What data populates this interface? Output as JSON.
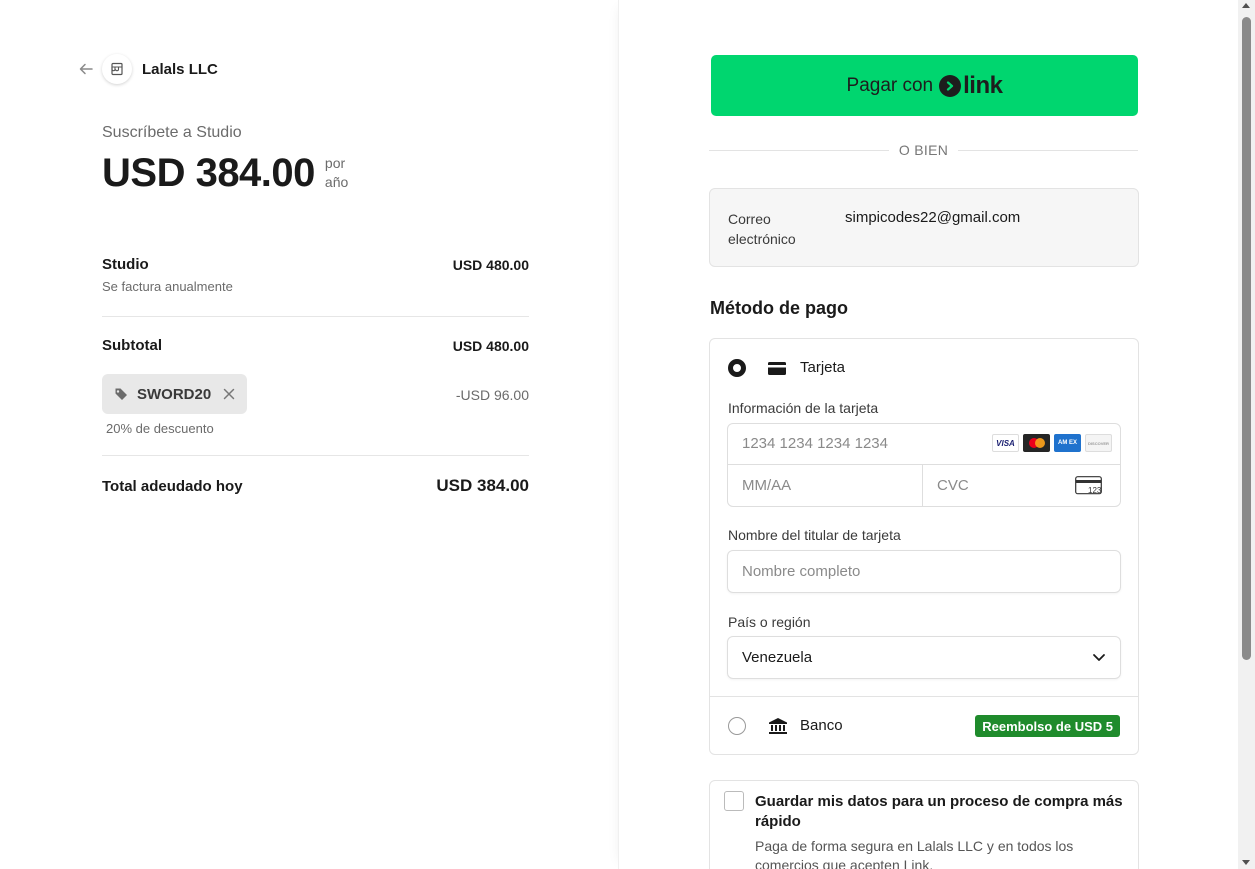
{
  "merchant": {
    "name": "Lalals LLC"
  },
  "summary": {
    "subscribe_label": "Suscríbete a Studio",
    "price": "USD 384.00",
    "period_line1": "por",
    "period_line2": "año"
  },
  "items": {
    "studio": {
      "title": "Studio",
      "subtitle": "Se factura anualmente",
      "amount": "USD 480.00"
    },
    "subtotal": {
      "title": "Subtotal",
      "amount": "USD 480.00"
    },
    "coupon": {
      "code": "SWORD20",
      "note": "20% de descuento",
      "amount": "-USD 96.00"
    },
    "total": {
      "title": "Total adeudado hoy",
      "amount": "USD 384.00"
    }
  },
  "link_button": {
    "label": "Pagar con",
    "logo_word": "link"
  },
  "or_text": "O BIEN",
  "email": {
    "label": "Correo electrónico",
    "value": "simpicodes22@gmail.com"
  },
  "payment": {
    "title": "Método de pago",
    "card": {
      "label": "Tarjeta",
      "card_info_label": "Información de la tarjeta",
      "number_placeholder": "1234 1234 1234 1234",
      "expiry_placeholder": "MM/AA",
      "cvc_placeholder": "CVC",
      "cvc_icon_text": "123",
      "brands": {
        "visa": "VISA",
        "amex": "AM EX",
        "discover": "DISCOVER"
      },
      "holder_label": "Nombre del titular de tarjeta",
      "holder_placeholder": "Nombre completo",
      "country_label": "País o región",
      "country_value": "Venezuela"
    },
    "bank": {
      "label": "Banco",
      "badge": "Reembolso de USD 5"
    }
  },
  "save_info": {
    "title": "Guardar mis datos para un proceso de compra más rápido",
    "description": "Paga de forma segura en Lalals LLC y en todos los comercios que acepten Link."
  },
  "colors": {
    "link_green": "#00d66f",
    "rebate_green": "#1f8b2c"
  }
}
